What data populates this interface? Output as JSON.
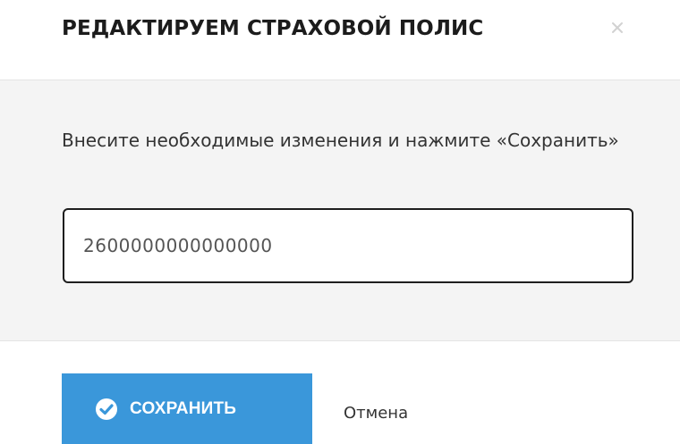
{
  "dialog": {
    "title": "РЕДАКТИРУЕМ СТРАХОВОЙ ПОЛИС",
    "close_icon": "close-icon"
  },
  "body": {
    "instructions": "Внесите необходимые изменения и нажмите «Сохранить»",
    "policy_input": {
      "value": "2600000000000000",
      "placeholder": ""
    }
  },
  "footer": {
    "save_label": "СОХРАНИТЬ",
    "save_icon": "check-circle-icon",
    "cancel_label": "Отмена"
  },
  "colors": {
    "primary": "#3a97da",
    "body_bg": "#f4f4f4",
    "title": "#1c1c1c",
    "close": "#d2d2d2"
  }
}
